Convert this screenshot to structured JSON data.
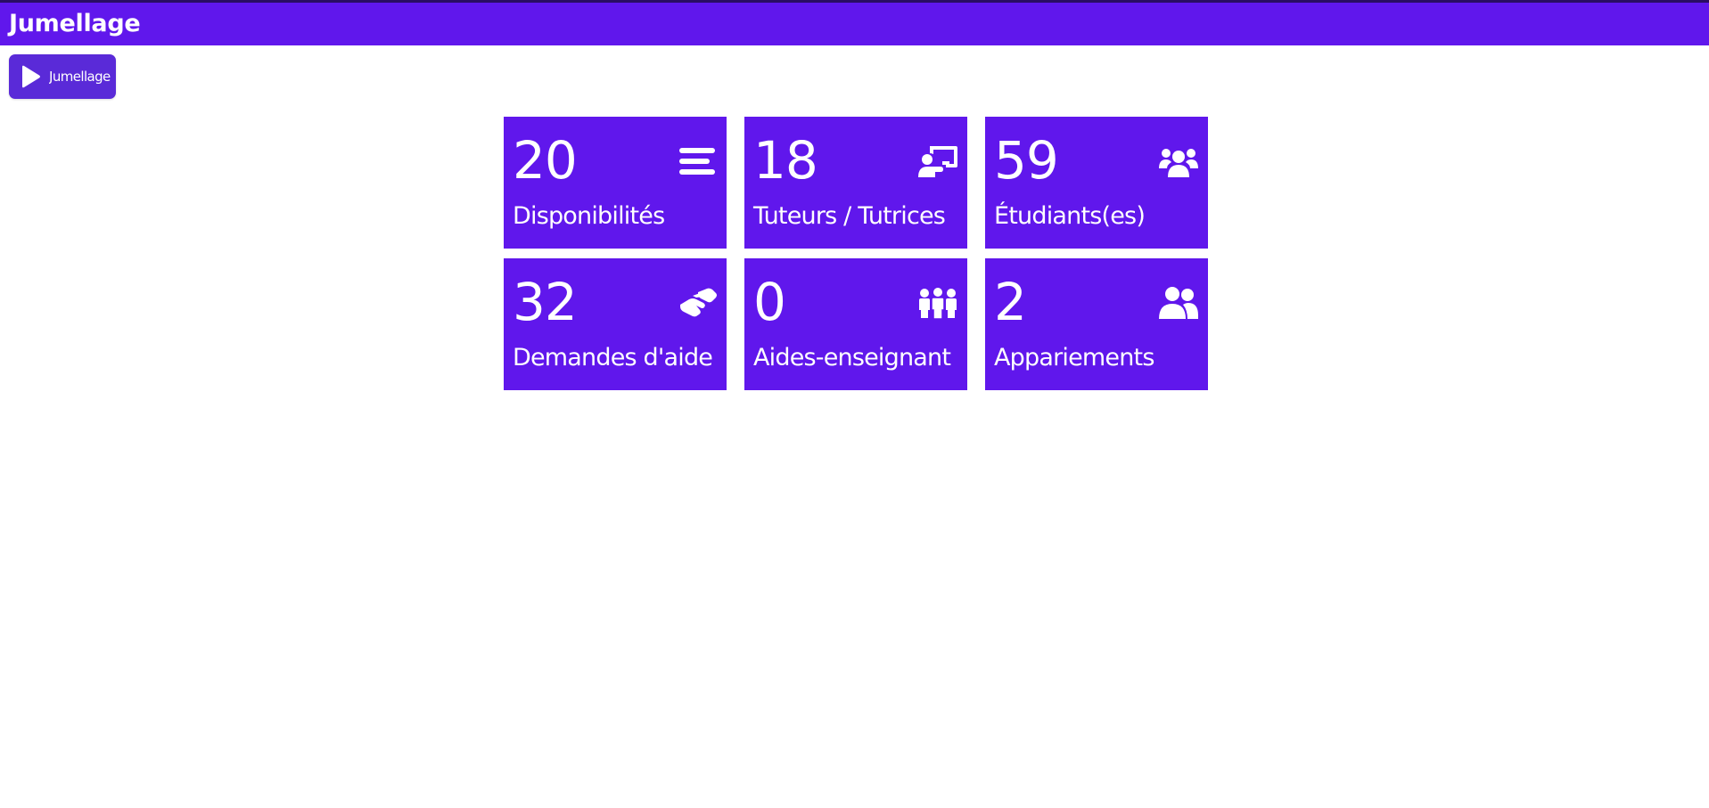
{
  "header": {
    "title": "Jumellage",
    "background_color": "#6017ec"
  },
  "launcher": {
    "label": "Jumellage",
    "icon": "play-icon"
  },
  "tiles": [
    {
      "count": "20",
      "label": "Disponibilités",
      "icon": "list-icon"
    },
    {
      "count": "18",
      "label": "Tuteurs / Tutrices",
      "icon": "chalkboard-teacher-icon"
    },
    {
      "count": "59",
      "label": "Étudiants(es)",
      "icon": "users-group-icon"
    },
    {
      "count": "32",
      "label": "Demandes d'aide",
      "icon": "handshake-icon"
    },
    {
      "count": "0",
      "label": "Aides-enseignant",
      "icon": "people-group-icon"
    },
    {
      "count": "2",
      "label": "Appariements",
      "icon": "user-pair-icon"
    }
  ],
  "colors": {
    "tile_background": "#6017ec",
    "launcher_background": "#5a2ad8",
    "text": "#ffffff"
  }
}
